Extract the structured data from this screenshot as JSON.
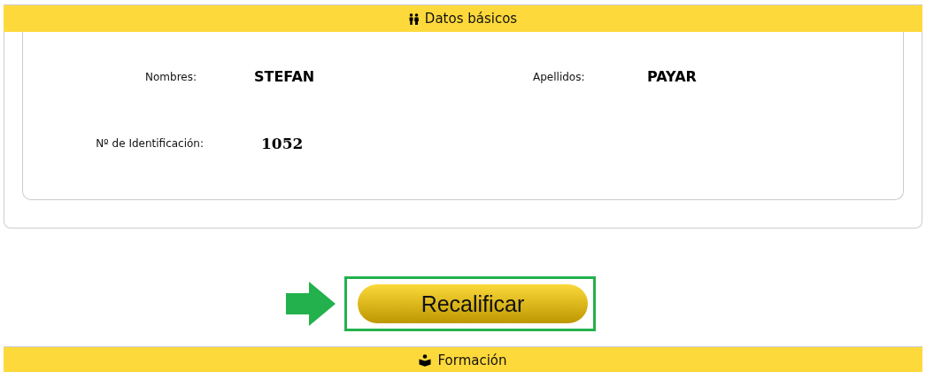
{
  "sections": [
    {
      "title": "Datos básicos"
    },
    {
      "title": "Formación"
    }
  ],
  "fields": [
    {
      "label": "Nombres:",
      "value": "STEFAN",
      "kind": "text"
    },
    {
      "label": "Apellidos:",
      "value": "PAYAR",
      "kind": "text"
    },
    {
      "label": "Nº de Identificación:",
      "value": "1052",
      "kind": "number"
    }
  ],
  "action": {
    "label": "Recalificar",
    "highlighted": true
  }
}
